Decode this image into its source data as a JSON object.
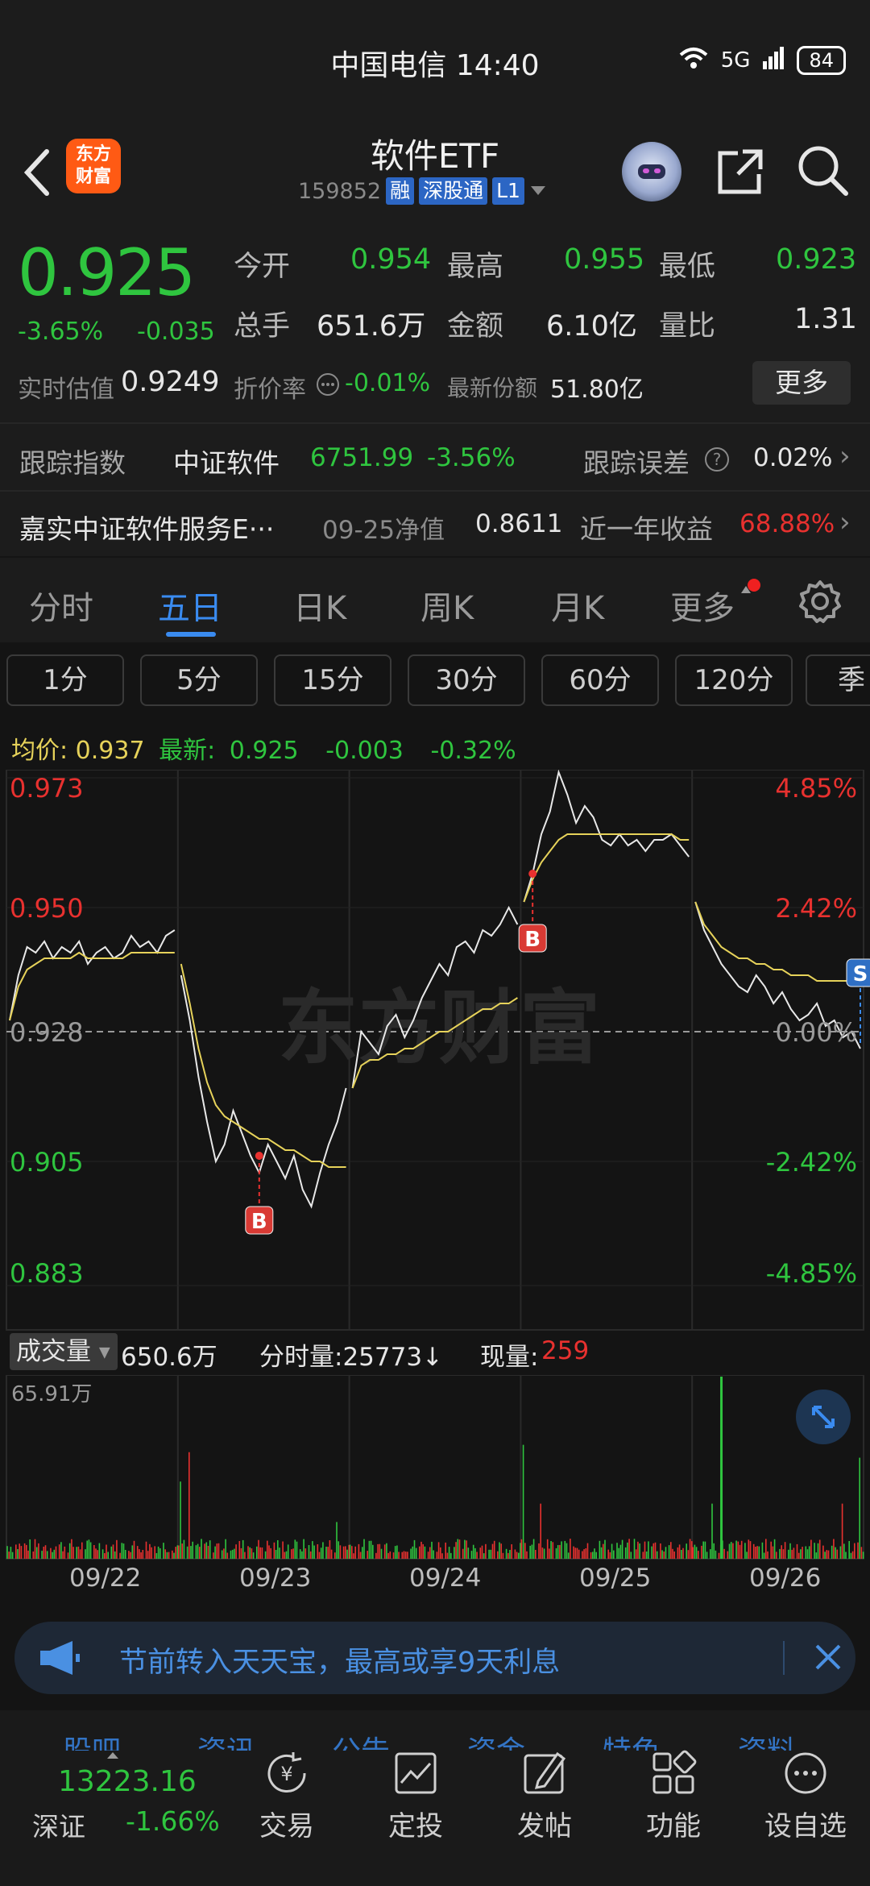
{
  "status_bar": {
    "carrier_time": "中国电信 14:40",
    "signal": "5G",
    "battery": "84"
  },
  "header": {
    "logo_line1": "东方",
    "logo_line2": "财富",
    "title": "软件ETF",
    "code": "159852",
    "tags": [
      "融",
      "深股通",
      "L1"
    ]
  },
  "quote": {
    "price": "0.925",
    "change_pct": "-3.65%",
    "change": "-0.035",
    "open_label": "今开",
    "open": "0.954",
    "high_label": "最高",
    "high": "0.955",
    "low_label": "最低",
    "low": "0.923",
    "volume_label": "总手",
    "volume": "651.6万",
    "amount_label": "金额",
    "amount": "6.10亿",
    "ratio_label": "量比",
    "ratio": "1.31",
    "iopv_label": "实时估值",
    "iopv": "0.9249",
    "discount_label": "折价率",
    "discount": "-0.01%",
    "shares_label": "最新份额",
    "shares": "51.80亿",
    "more_label": "更多"
  },
  "tracking": {
    "label": "跟踪指数",
    "index_name": "中证软件",
    "index_value": "6751.99",
    "index_change": "-3.56%",
    "error_label": "跟踪误差",
    "error": "0.02%"
  },
  "fund": {
    "name": "嘉实中证软件服务E···",
    "nav_date_label": "09-25净值",
    "nav": "0.8611",
    "year_return_label": "近一年收益",
    "year_return": "68.88%"
  },
  "tabs": [
    "分时",
    "五日",
    "日K",
    "周K",
    "月K",
    "更多"
  ],
  "active_tab": "五日",
  "periods": [
    "1分",
    "5分",
    "15分",
    "30分",
    "60分",
    "120分",
    "季"
  ],
  "avg_row": {
    "avg_label": "均价:",
    "avg": "0.937",
    "latest_label": "最新:",
    "latest": "0.925",
    "chg": "-0.003",
    "pct": "-0.32%"
  },
  "chart_data": {
    "type": "line",
    "title": "",
    "y_left_labels": [
      "0.973",
      "0.950",
      "0.928",
      "0.905",
      "0.883"
    ],
    "y_right_labels": [
      "4.85%",
      "2.42%",
      "0.00%",
      "-2.42%",
      "-4.85%"
    ],
    "ylim": [
      0.883,
      0.973
    ],
    "prev_close": 0.928,
    "x_labels": [
      "09/22",
      "09/23",
      "09/24",
      "09/25",
      "09/26"
    ],
    "series": [
      {
        "values": [
          0.93,
          0.938,
          0.943,
          0.942,
          0.944,
          0.941,
          0.943,
          0.942,
          0.944,
          0.94,
          0.942,
          0.943,
          0.941,
          0.942,
          0.945,
          0.943,
          0.944,
          0.942,
          0.945,
          0.946,
          0.938,
          0.93,
          0.92,
          0.912,
          0.905,
          0.908,
          0.914,
          0.91,
          0.906,
          0.903,
          0.908,
          0.905,
          0.902,
          0.906,
          0.9,
          0.897,
          0.903,
          0.908,
          0.912,
          0.918,
          0.918,
          0.928,
          0.926,
          0.924,
          0.929,
          0.931,
          0.927,
          0.93,
          0.934,
          0.937,
          0.94,
          0.938,
          0.943,
          0.944,
          0.942,
          0.946,
          0.945,
          0.947,
          0.95,
          0.947,
          0.951,
          0.956,
          0.963,
          0.967,
          0.974,
          0.97,
          0.965,
          0.968,
          0.966,
          0.962,
          0.961,
          0.963,
          0.961,
          0.962,
          0.96,
          0.962,
          0.962,
          0.963,
          0.961,
          0.959,
          0.951,
          0.946,
          0.943,
          0.94,
          0.938,
          0.936,
          0.935,
          0.938,
          0.936,
          0.933,
          0.935,
          0.932,
          0.93,
          0.931,
          0.933,
          0.929,
          0.93,
          0.927,
          0.928,
          0.925
        ]
      },
      {
        "values": [
          0.93,
          0.936,
          0.939,
          0.94,
          0.941,
          0.941,
          0.941,
          0.941,
          0.942,
          0.941,
          0.941,
          0.941,
          0.941,
          0.941,
          0.942,
          0.942,
          0.942,
          0.942,
          0.942,
          0.942,
          0.94,
          0.933,
          0.925,
          0.919,
          0.915,
          0.913,
          0.912,
          0.911,
          0.91,
          0.909,
          0.909,
          0.908,
          0.907,
          0.907,
          0.906,
          0.905,
          0.905,
          0.904,
          0.904,
          0.904,
          0.918,
          0.922,
          0.923,
          0.923,
          0.924,
          0.924,
          0.925,
          0.925,
          0.926,
          0.927,
          0.928,
          0.928,
          0.929,
          0.93,
          0.931,
          0.932,
          0.932,
          0.933,
          0.933,
          0.934,
          0.951,
          0.955,
          0.958,
          0.96,
          0.962,
          0.963,
          0.963,
          0.963,
          0.963,
          0.963,
          0.963,
          0.963,
          0.963,
          0.963,
          0.963,
          0.963,
          0.963,
          0.963,
          0.962,
          0.962,
          0.951,
          0.947,
          0.945,
          0.943,
          0.942,
          0.941,
          0.941,
          0.94,
          0.94,
          0.939,
          0.939,
          0.938,
          0.938,
          0.938,
          0.937,
          0.937,
          0.937,
          0.937,
          0.937,
          0.937
        ]
      }
    ],
    "markers": [
      {
        "label": "B",
        "type": "buy",
        "x_index": 29,
        "value": 0.906
      },
      {
        "label": "B",
        "type": "buy",
        "x_index": 61,
        "value": 0.956
      },
      {
        "label": "S",
        "type": "sell",
        "x_index": 99,
        "value": 0.937
      }
    ],
    "volume": {
      "label": "成交量",
      "total": "650.6万",
      "tick_label": "分时量:25773↓",
      "now_label": "现量:",
      "now": "259",
      "max_label": "65.91万"
    }
  },
  "watermark": "东方财富",
  "banner": {
    "text": "节前转入天天宝，最高或享9天利息"
  },
  "bottom_hidden_tabs": [
    "股吧",
    "资讯",
    "公告",
    "资金",
    "特色",
    "资料"
  ],
  "bottom": {
    "index_value": "13223.16",
    "index_name": "深证",
    "index_change": "-1.66%",
    "nav": [
      "交易",
      "定投",
      "发帖",
      "功能",
      "设自选"
    ]
  },
  "colors": {
    "up": "#e8312f",
    "down": "#2fc53f",
    "accent": "#3a8bf0",
    "avg_line": "#e6d25a"
  }
}
